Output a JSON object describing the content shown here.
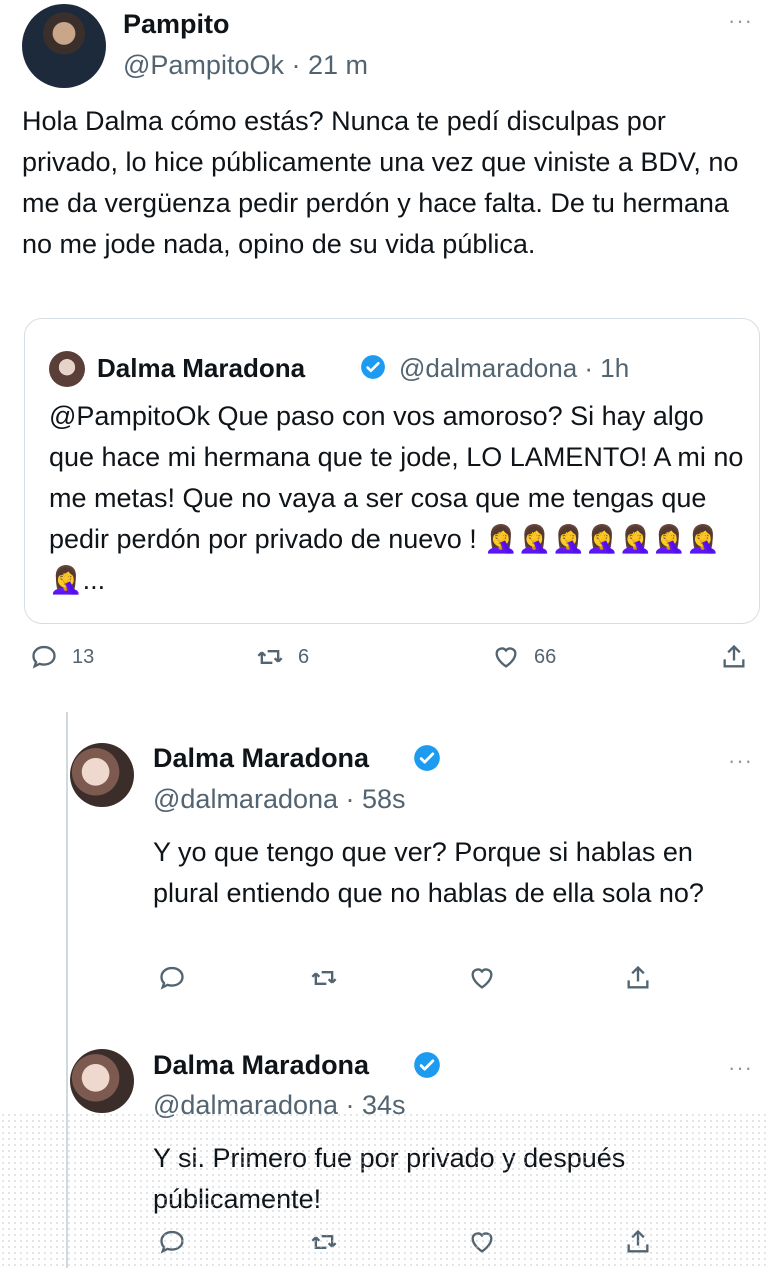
{
  "main_tweet": {
    "display_name": "Pampito",
    "handle_time": "@PampitoOk · 21 m",
    "text": "Hola Dalma cómo estás? Nunca te pedí disculpas por privado, lo hice públicamente una vez que viniste a BDV, no me da vergüenza pedir perdón y hace falta. De tu hermana no me jode nada, opino de su vida pública.",
    "more_icon": "···",
    "quoted": {
      "display_name": "Dalma Maradona",
      "handle_time": "@dalmaradona · 1h",
      "text": "@PampitoOk Que paso con vos amoroso? Si hay algo que hace mi hermana que te jode, LO LAMENTO! A mi no me metas! Que no vaya a ser cosa que me tengas que pedir perdón por privado de nuevo ! 🤦‍♀️🤦‍♀️🤦‍♀️🤦‍♀️🤦‍♀️🤦‍♀️🤦‍♀️🤦‍♀️..."
    },
    "actions": {
      "replies": "13",
      "retweets": "6",
      "likes": "66"
    }
  },
  "replies": [
    {
      "display_name": "Dalma Maradona",
      "handle_time": "@dalmaradona · 58s",
      "text": "Y yo que tengo que ver? Porque si hablas en plural entiendo que no hablas de ella sola no?",
      "more_icon": "···"
    },
    {
      "display_name": "Dalma Maradona",
      "handle_time": "@dalmaradona · 34s",
      "text": "Y si. Primero fue por privado y después públicamente!",
      "more_icon": "···"
    }
  ],
  "colors": {
    "verified": "#1d9bf0",
    "muted": "#536471",
    "text": "#0f1419",
    "border": "#cfd9de"
  }
}
